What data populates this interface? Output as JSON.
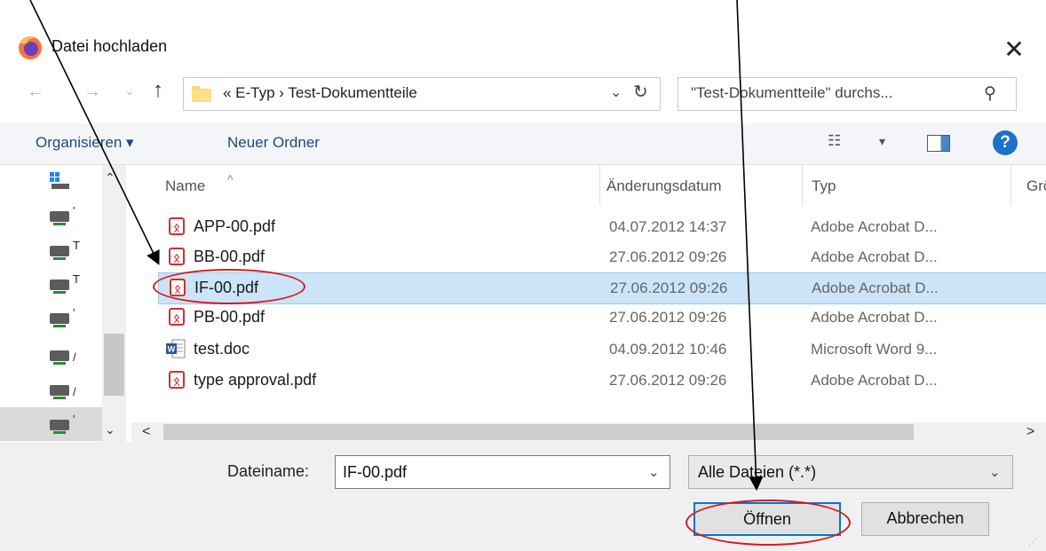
{
  "window": {
    "title": "Datei hochladen",
    "close_glyph": "✕"
  },
  "nav": {
    "back_glyph": "←",
    "forward_glyph": "→",
    "recent_glyph": "⌄",
    "up_glyph": "↑",
    "address": "«  E-Typ  ›  Test-Dokumentteile",
    "address_dropdown_glyph": "⌄",
    "refresh_glyph": "↻",
    "search_placeholder": "\"Test-Dokumentteile\" durchs...",
    "search_glyph": "⚲"
  },
  "toolbar": {
    "organize_label": "Organisieren ▾",
    "new_folder_label": "Neuer Ordner",
    "view_glyph": "☷",
    "view_dropdown_glyph": "▾",
    "help_glyph": "?"
  },
  "navpane": {
    "items": [
      "",
      "'",
      "T",
      "T",
      "'",
      "/",
      "/",
      "'"
    ],
    "scroll_up_glyph": "⌃",
    "scroll_down_glyph": "⌄"
  },
  "columns": {
    "name": "Name",
    "date": "Änderungsdatum",
    "type": "Typ",
    "size": "Grö",
    "sort_glyph": "^"
  },
  "files": [
    {
      "name": "APP-00.pdf",
      "date": "04.07.2012 14:37",
      "type": "Adobe Acrobat D...",
      "kind": "pdf"
    },
    {
      "name": "BB-00.pdf",
      "date": "27.06.2012 09:26",
      "type": "Adobe Acrobat D...",
      "kind": "pdf"
    },
    {
      "name": "IF-00.pdf",
      "date": "27.06.2012 09:26",
      "type": "Adobe Acrobat D...",
      "kind": "pdf",
      "selected": true
    },
    {
      "name": "PB-00.pdf",
      "date": "27.06.2012 09:26",
      "type": "Adobe Acrobat D...",
      "kind": "pdf"
    },
    {
      "name": "test.doc",
      "date": "04.09.2012 10:46",
      "type": "Microsoft Word 9...",
      "kind": "doc"
    },
    {
      "name": "type approval.pdf",
      "date": "27.06.2012 09:26",
      "type": "Adobe Acrobat D...",
      "kind": "pdf"
    }
  ],
  "hscroll": {
    "left_glyph": "<",
    "right_glyph": ">"
  },
  "bottom": {
    "filename_label": "Dateiname:",
    "filename_value": "IF-00.pdf",
    "filename_dropdown_glyph": "⌄",
    "filter_value": "Alle Dateien (*.*)",
    "filter_dropdown_glyph": "⌄",
    "open_label": "Öffnen",
    "cancel_label": "Abbrechen"
  },
  "colors": {
    "selection": "#cce4f7",
    "accent": "#0078d7",
    "annotation": "#d7191c",
    "pdf_icon": "#d32f2f"
  }
}
